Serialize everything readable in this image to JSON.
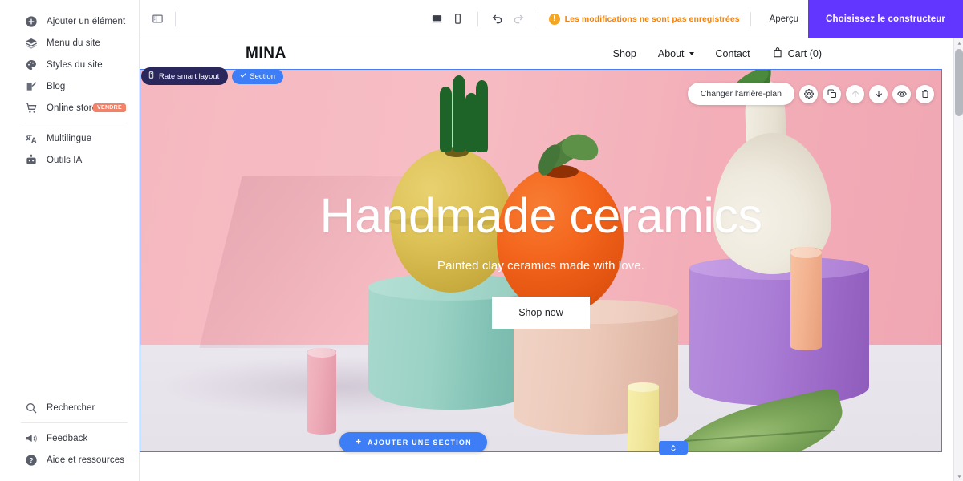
{
  "sidebar": {
    "top_items": [
      {
        "label": "Ajouter un élément",
        "icon": "plus-circle-icon"
      },
      {
        "label": "Menu du site",
        "icon": "layers-icon"
      },
      {
        "label": "Styles du site",
        "icon": "palette-icon"
      },
      {
        "label": "Blog",
        "icon": "edit-pencil-icon"
      },
      {
        "label": "Online store",
        "icon": "shopping-cart-icon",
        "badge": "VENDRE"
      }
    ],
    "bottom_group_items": [
      {
        "label": "Multilingue",
        "icon": "translate-icon"
      },
      {
        "label": "Outils IA",
        "icon": "robot-icon"
      }
    ],
    "footer_items": [
      {
        "label": "Rechercher",
        "icon": "search-icon"
      },
      {
        "label": "Feedback",
        "icon": "megaphone-icon"
      },
      {
        "label": "Aide et ressources",
        "icon": "help-circle-icon"
      }
    ]
  },
  "toolbar": {
    "panel_toggle_icon": "panel-layout-icon",
    "desktop_icon": "desktop-icon",
    "mobile_icon": "mobile-icon",
    "undo_icon": "undo-icon",
    "redo_icon": "redo-icon",
    "warning_mark": "!",
    "warning_text": "Les modifications ne sont pas enregistrées",
    "preview_label": "Aperçu",
    "cta_label": "Choisissez le constructeur",
    "cta_color": "#6236ff",
    "warning_color": "#f0820f"
  },
  "site_header": {
    "logo": "MINA",
    "nav": [
      {
        "label": "Shop",
        "has_dropdown": false
      },
      {
        "label": "About",
        "has_dropdown": true
      },
      {
        "label": "Contact",
        "has_dropdown": false
      }
    ],
    "cart_label": "Cart (0)",
    "cart_icon": "shopping-bag-icon"
  },
  "hero": {
    "title": "Handmade ceramics",
    "subtitle": "Painted clay ceramics made with love.",
    "cta_label": "Shop now"
  },
  "editor_overlays": {
    "smart_layout_badge": "Rate smart layout",
    "smart_layout_badge_color": "#29275c",
    "section_badge": "Section",
    "section_badge_color": "#3d7df5",
    "change_background_label": "Changer l'arrière-plan",
    "float_icons": [
      {
        "name": "settings-gear-icon",
        "disabled": false
      },
      {
        "name": "duplicate-icon",
        "disabled": false
      },
      {
        "name": "move-up-icon",
        "disabled": true
      },
      {
        "name": "move-down-icon",
        "disabled": false
      },
      {
        "name": "eye-hide-icon",
        "disabled": false
      },
      {
        "name": "trash-icon",
        "disabled": false
      }
    ],
    "add_section_label": "AJOUTER UNE SECTION",
    "add_section_color": "#3d7df5",
    "selection_border_color": "#4a7cf5"
  }
}
